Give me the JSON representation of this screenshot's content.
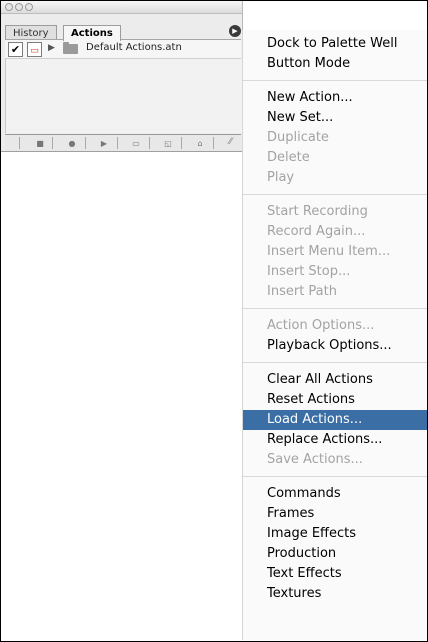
{
  "palette": {
    "tabs": [
      {
        "label": "History",
        "active": false
      },
      {
        "label": "Actions",
        "active": true
      }
    ],
    "set_name": "Default Actions.atn",
    "toolbar_icons": [
      "stop-icon",
      "record-icon",
      "play-icon",
      "new-set-icon",
      "new-action-icon",
      "trash-icon"
    ],
    "menu_button_icon": "triangle-right-icon"
  },
  "menu": {
    "groups": [
      [
        {
          "label": "Dock to Palette Well",
          "enabled": true
        },
        {
          "label": "Button Mode",
          "enabled": true
        }
      ],
      [
        {
          "label": "New Action...",
          "enabled": true
        },
        {
          "label": "New Set...",
          "enabled": true
        },
        {
          "label": "Duplicate",
          "enabled": false
        },
        {
          "label": "Delete",
          "enabled": false
        },
        {
          "label": "Play",
          "enabled": false
        }
      ],
      [
        {
          "label": "Start Recording",
          "enabled": false
        },
        {
          "label": "Record Again...",
          "enabled": false
        },
        {
          "label": "Insert Menu Item...",
          "enabled": false
        },
        {
          "label": "Insert Stop...",
          "enabled": false
        },
        {
          "label": "Insert Path",
          "enabled": false
        }
      ],
      [
        {
          "label": "Action Options...",
          "enabled": false
        },
        {
          "label": "Playback Options...",
          "enabled": true
        }
      ],
      [
        {
          "label": "Clear All Actions",
          "enabled": true
        },
        {
          "label": "Reset Actions",
          "enabled": true
        },
        {
          "label": "Load Actions...",
          "enabled": true,
          "selected": true
        },
        {
          "label": "Replace Actions...",
          "enabled": true
        },
        {
          "label": "Save Actions...",
          "enabled": false
        }
      ],
      [
        {
          "label": "Commands",
          "enabled": true
        },
        {
          "label": "Frames",
          "enabled": true
        },
        {
          "label": "Image Effects",
          "enabled": true
        },
        {
          "label": "Production",
          "enabled": true
        },
        {
          "label": "Text Effects",
          "enabled": true
        },
        {
          "label": "Textures",
          "enabled": true
        }
      ]
    ]
  },
  "colors": {
    "selection": "#3a6ea5",
    "disabled_text": "#a3a3a3"
  }
}
